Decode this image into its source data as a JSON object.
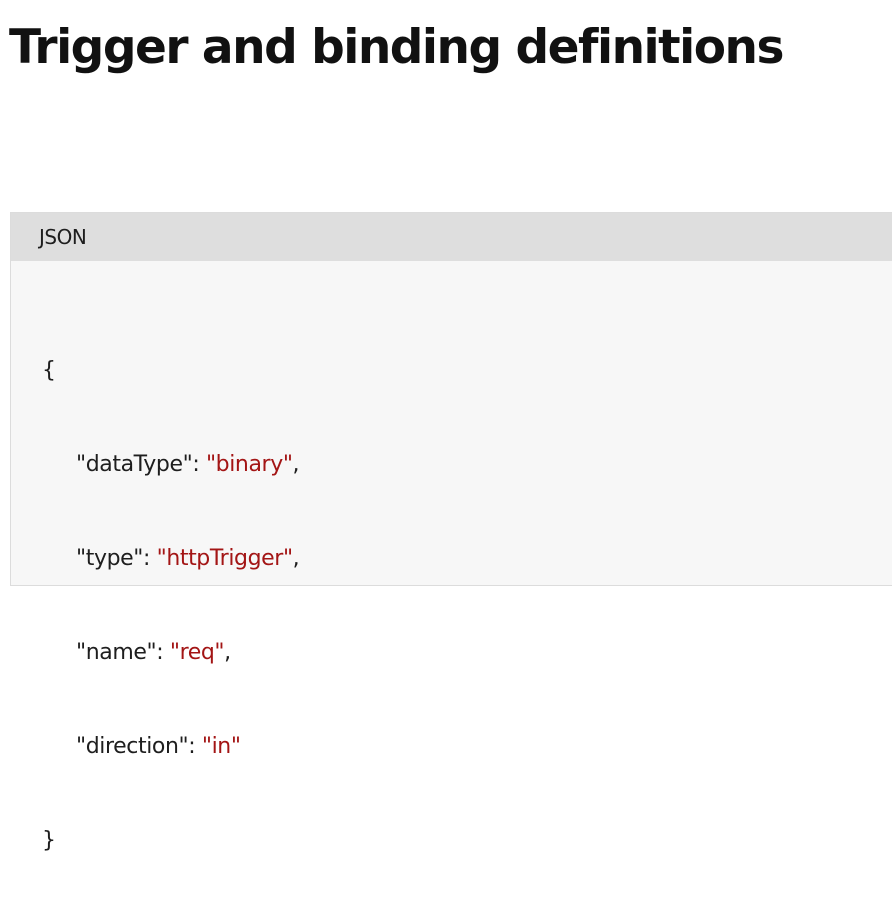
{
  "page": {
    "title": "Trigger and binding definitions"
  },
  "code_block": {
    "language": "JSON",
    "open_brace": "{",
    "close_brace": "}",
    "entries": [
      {
        "key": "\"dataType\"",
        "value": "\"binary\"",
        "trailing": ","
      },
      {
        "key": "\"type\"",
        "value": "\"httpTrigger\"",
        "trailing": ","
      },
      {
        "key": "\"name\"",
        "value": "\"req\"",
        "trailing": ","
      },
      {
        "key": "\"direction\"",
        "value": "\"in\"",
        "trailing": ""
      }
    ]
  },
  "colors": {
    "string_value": "#a31515",
    "text": "#1e1e1e",
    "header_bg": "#dedede",
    "block_bg": "#f7f7f7"
  }
}
